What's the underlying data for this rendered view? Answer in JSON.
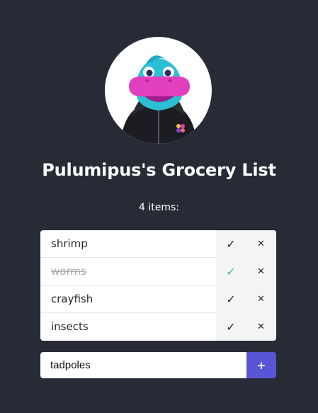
{
  "header": {
    "title": "Pulumipus's Grocery List",
    "item_count_text": "4 items:"
  },
  "avatar": {
    "icon": "pulumipus-mascot-icon"
  },
  "list": {
    "items": [
      {
        "label": "shrimp",
        "done": false,
        "check_symbol": "✓",
        "delete_symbol": "✕"
      },
      {
        "label": "worms",
        "done": true,
        "check_symbol": "✓",
        "delete_symbol": "✕"
      },
      {
        "label": "crayfish",
        "done": false,
        "check_symbol": "✓",
        "delete_symbol": "✕"
      },
      {
        "label": "insects",
        "done": false,
        "check_symbol": "✓",
        "delete_symbol": "✕"
      }
    ]
  },
  "add_form": {
    "input_value": "tadpoles",
    "add_symbol": "+"
  },
  "colors": {
    "background": "#262b35",
    "accent": "#5a55d4",
    "done_check": "#3fbf8f"
  }
}
